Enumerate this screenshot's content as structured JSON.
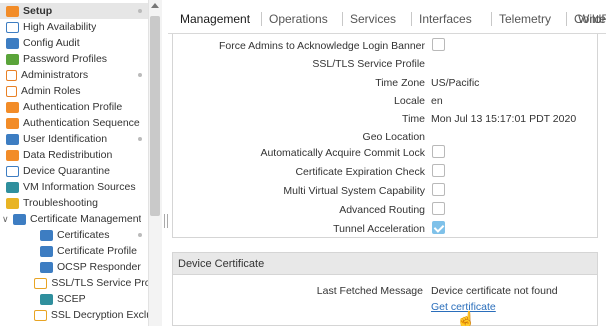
{
  "sidebar": {
    "items": [
      {
        "label": "Setup",
        "icon": "setup-icon",
        "selected": true,
        "dot": true
      },
      {
        "label": "High Availability",
        "icon": "high-availability-icon",
        "dot": false
      },
      {
        "label": "Config Audit",
        "icon": "config-audit-icon",
        "dot": false
      },
      {
        "label": "Password Profiles",
        "icon": "password-profiles-icon",
        "dot": false
      },
      {
        "label": "Administrators",
        "icon": "administrators-icon",
        "dot": true
      },
      {
        "label": "Admin Roles",
        "icon": "admin-roles-icon",
        "dot": false
      },
      {
        "label": "Authentication Profile",
        "icon": "authentication-profile-icon",
        "dot": false
      },
      {
        "label": "Authentication Sequence",
        "icon": "authentication-sequence-icon",
        "dot": false
      },
      {
        "label": "User Identification",
        "icon": "user-identification-icon",
        "dot": true
      },
      {
        "label": "Data Redistribution",
        "icon": "data-redistribution-icon",
        "dot": false
      },
      {
        "label": "Device Quarantine",
        "icon": "device-quarantine-icon",
        "dot": false
      },
      {
        "label": "VM Information Sources",
        "icon": "vm-information-sources-icon",
        "dot": false
      },
      {
        "label": "Troubleshooting",
        "icon": "troubleshooting-icon",
        "dot": false
      },
      {
        "label": "Certificate Management",
        "icon": "certificate-management-icon",
        "dot": false,
        "expanded": true
      },
      {
        "label": "Certificates",
        "icon": "certificates-icon",
        "dot": true
      },
      {
        "label": "Certificate Profile",
        "icon": "certificate-profile-icon",
        "dot": false
      },
      {
        "label": "OCSP Responder",
        "icon": "ocsp-responder-icon",
        "dot": false
      },
      {
        "label": "SSL/TLS Service Profile",
        "icon": "ssl-tls-service-profile-icon",
        "dot": false
      },
      {
        "label": "SCEP",
        "icon": "scep-icon",
        "dot": false
      },
      {
        "label": "SSL Decryption Exclusio",
        "icon": "ssl-decryption-exclusion-icon",
        "dot": false
      }
    ]
  },
  "tabs": [
    "Management",
    "Operations",
    "Services",
    "Interfaces",
    "Telemetry",
    "Content-ID",
    "WildFi"
  ],
  "active_tab": "Management",
  "settings": {
    "force_admins": {
      "label": "Force Admins to Acknowledge Login Banner",
      "checked": false
    },
    "ssl_tls_profile": {
      "label": "SSL/TLS Service Profile",
      "value": ""
    },
    "time_zone": {
      "label": "Time Zone",
      "value": "US/Pacific"
    },
    "locale": {
      "label": "Locale",
      "value": "en"
    },
    "time": {
      "label": "Time",
      "value": "Mon Jul 13 15:17:01 PDT 2020"
    },
    "geo_location": {
      "label": "Geo Location",
      "value": ""
    },
    "auto_commit_lock": {
      "label": "Automatically Acquire Commit Lock",
      "checked": false
    },
    "cert_expiration_check": {
      "label": "Certificate Expiration Check",
      "checked": false
    },
    "multi_vsys": {
      "label": "Multi Virtual System Capability",
      "checked": false
    },
    "advanced_routing": {
      "label": "Advanced Routing",
      "checked": false
    },
    "tunnel_acceleration": {
      "label": "Tunnel Acceleration",
      "checked": true
    }
  },
  "device_certificate": {
    "title": "Device Certificate",
    "last_fetched_label": "Last Fetched Message",
    "last_fetched_value": "Device certificate not found",
    "get_certificate_link": "Get certificate"
  },
  "colors": {
    "accent_link": "#2a6ebb",
    "checkbox_checked": "#7fc1e9",
    "selected_row": "#e6e6e6",
    "section_header": "#e8e8e8"
  }
}
